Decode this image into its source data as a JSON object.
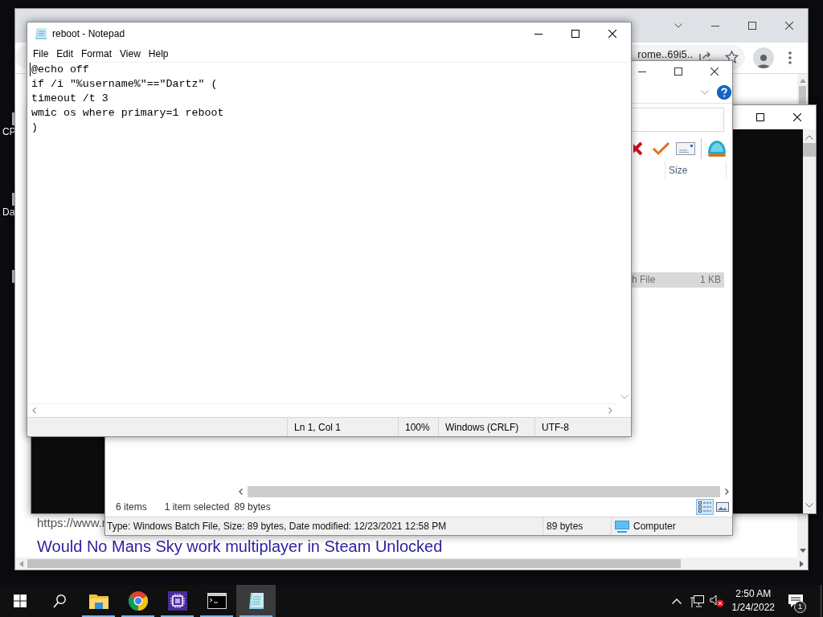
{
  "desktop": {
    "icons": [
      {
        "label": "CP"
      },
      {
        "label": "Da"
      }
    ]
  },
  "browser": {
    "address_text": "rome..69i5..",
    "page": {
      "url_text": "https://www.r",
      "result_title": "Would No Mans Sky work multiplayer in Steam Unlocked"
    }
  },
  "file_window": {
    "column_header": "Size",
    "rows": [
      {
        "type": "h File",
        "size": "1 KB",
        "selected": true
      }
    ],
    "status": {
      "item_count": "6 items",
      "selection": "1 item selected",
      "selection_size": "89 bytes"
    },
    "views": [
      {
        "kind": "details",
        "selected": true
      },
      {
        "kind": "preview",
        "selected": false
      }
    ],
    "details_bar": {
      "description": "Type: Windows Batch File, Size: 89 bytes, Date modified: 12/23/2021 12:58 PM",
      "size": "89 bytes",
      "zone": "Computer"
    }
  },
  "notepad": {
    "title": "reboot - Notepad",
    "menu": [
      "File",
      "Edit",
      "Format",
      "View",
      "Help"
    ],
    "lines": [
      "@echo off",
      "if /i \"%username%\"==\"Dartz\" (",
      "timeout /t 3",
      "wmic os where primary=1 reboot",
      ")"
    ],
    "status": {
      "position": "Ln 1, Col 1",
      "zoom": "100%",
      "line_ending": "Windows (CRLF)",
      "encoding": "UTF-8"
    }
  },
  "taskbar": {
    "apps": [
      {
        "kind": "explorer",
        "running": true,
        "selected": false
      },
      {
        "kind": "browser",
        "running": true,
        "selected": false
      },
      {
        "kind": "chip",
        "running": true,
        "selected": false
      },
      {
        "kind": "terminal",
        "running": true,
        "selected": false
      },
      {
        "kind": "notepad",
        "running": true,
        "selected": true
      }
    ],
    "clock": {
      "time": "2:50 AM",
      "date": "1/24/2022"
    },
    "notifications": {
      "count": "1"
    }
  }
}
